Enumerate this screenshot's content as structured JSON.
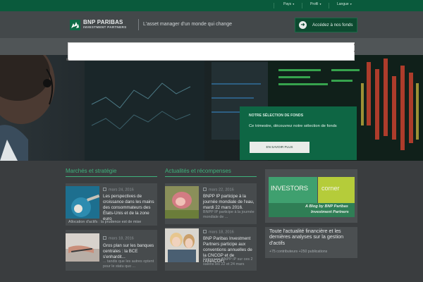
{
  "topbar": {
    "items": [
      {
        "label": "Pays"
      },
      {
        "label": "Profil"
      },
      {
        "label": "Langue"
      }
    ]
  },
  "header": {
    "logo_brand": "BNP PARIBAS",
    "logo_sub": "INVESTMENT PARTNERS",
    "tagline": "L'asset manager d'un monde qui change",
    "fund_button": "Accédez à nos fonds"
  },
  "promo": {
    "kicker": "NOTRE SÉLECTION DE FONDS",
    "text": "Ce trimestre, découvrez notre sélection de fonds",
    "button": "EN SAVOIR PLUS"
  },
  "markets": {
    "title": "Marchés et stratégie",
    "articles": [
      {
        "date": "mars 24, 2016",
        "headline": "Les perspectives de croissance dans les mains des consommateurs des États-Unis et de la zone euro",
        "snippet": "Allocation d'actifs : la prudence est de mise"
      },
      {
        "date": "mars 18, 2016",
        "headline": "Gros plan sur les banques centrales : la BCE s'enhardit...",
        "snippet": "... tandis que les autres optent pour le statu quo ..."
      }
    ]
  },
  "news": {
    "title": "Actualités et récompenses",
    "articles": [
      {
        "date": "mars 22, 2016",
        "headline": "BNPP IP participe à la journée mondiale de l'eau, mardi 22 mars 2016.",
        "snippet": "BNPP IP participe à la journée mondiale de ..."
      },
      {
        "date": "mars 18, 2016",
        "headline": "BNP Paribas Investment Partners participe aux conventions annuelles de la CNCGP et de l'ANACOFI",
        "snippet": "Retrouvez BNPP IP sur ces 2 salons les 22 et 24 mars"
      }
    ]
  },
  "blog": {
    "investors": "INVESTORS",
    "corner": "corner",
    "sub1": "A Blog by BNP Paribas",
    "sub2": "Investment Partners"
  },
  "all_news": {
    "title": "Toute l'actualité financière et les dernières analyses sur la gestion d'actifs",
    "meta": "+75 contributeurs  +250 publications"
  },
  "colors": {
    "brand_green": "#0e6644",
    "accent_green": "#3fb27c",
    "topbar": "#0a5a3c"
  }
}
